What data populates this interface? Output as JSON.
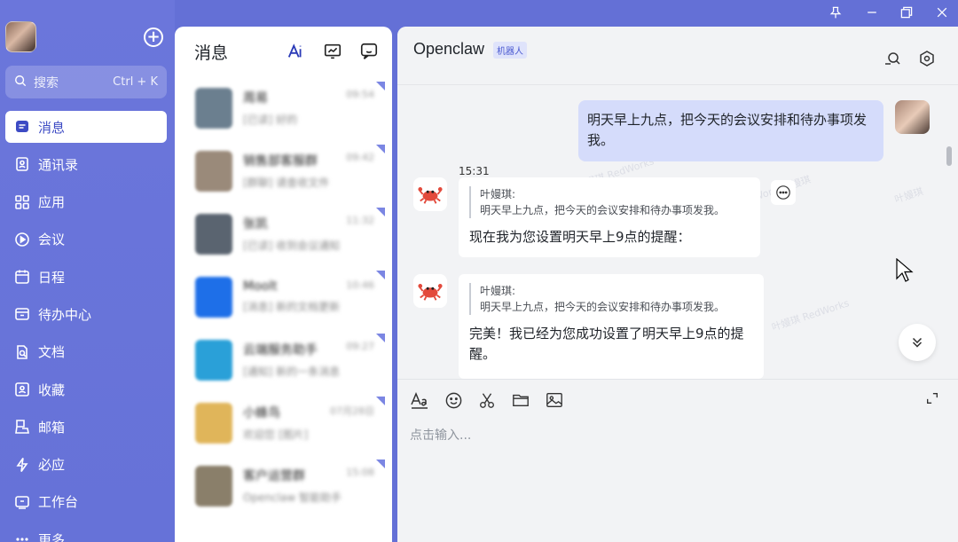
{
  "window": {
    "pin_icon": "pin-icon",
    "minimize_icon": "minimize-icon",
    "restore_icon": "restore-icon",
    "close_icon": "close-icon"
  },
  "sidebar": {
    "search_placeholder": "搜索",
    "search_shortcut": "Ctrl + K",
    "items": [
      {
        "label": "消息",
        "icon": "message-icon",
        "active": true
      },
      {
        "label": "通讯录",
        "icon": "contacts-icon"
      },
      {
        "label": "应用",
        "icon": "apps-icon"
      },
      {
        "label": "会议",
        "icon": "meeting-icon"
      },
      {
        "label": "日程",
        "icon": "calendar-icon"
      },
      {
        "label": "待办中心",
        "icon": "todo-icon"
      },
      {
        "label": "文档",
        "icon": "document-icon"
      },
      {
        "label": "收藏",
        "icon": "favorites-icon"
      },
      {
        "label": "邮箱",
        "icon": "mail-icon"
      },
      {
        "label": "必应",
        "icon": "lightning-icon"
      },
      {
        "label": "工作台",
        "icon": "workbench-icon"
      },
      {
        "label": "更多",
        "icon": "more-icon"
      }
    ]
  },
  "message_list": {
    "title": "消息",
    "conversations": [
      {
        "name": "周易",
        "time": "09:54",
        "preview": "[已读] 好的",
        "color": "#6b7f8f"
      },
      {
        "name": "销售部客服群",
        "time": "09:42",
        "preview": "[群聊] 请查收文件",
        "color": "#9a8a7a"
      },
      {
        "name": "张凯",
        "time": "11:32",
        "preview": "[已读] 收到会议通知",
        "color": "#5a6470"
      },
      {
        "name": "Moolt",
        "time": "10:46",
        "preview": "[消息] 新的文档更新",
        "color": "#1e6fe8"
      },
      {
        "name": "云端服务助手",
        "time": "09:27",
        "preview": "[通知] 新的一条消息",
        "color": "#2aa0d8"
      },
      {
        "name": "小蜂鸟",
        "time": "07月28日",
        "preview": "欢迎您 [图片]",
        "color": "#e0b55a"
      },
      {
        "name": "客户运营群",
        "time": "15:08",
        "preview": "Openclaw 智能助手",
        "color": "#8a7f6a"
      }
    ]
  },
  "chat": {
    "title": "Openclaw",
    "tag": "机器人",
    "my_message": "明天早上九点，把今天的会议安排和待办事项发我。",
    "time": "15:31",
    "bot_messages": [
      {
        "quote_author": "叶嫚琪:",
        "quote_text": "明天早上九点，把今天的会议安排和待办事项发我。",
        "reply": "现在我为您设置明天早上9点的提醒："
      },
      {
        "quote_author": "叶嫚琪:",
        "quote_text": "明天早上九点，把今天的会议安排和待办事项发我。",
        "reply": "完美！我已经为您成功设置了明天早上9点的提醒。"
      }
    ],
    "input_placeholder": "点击输入..."
  }
}
